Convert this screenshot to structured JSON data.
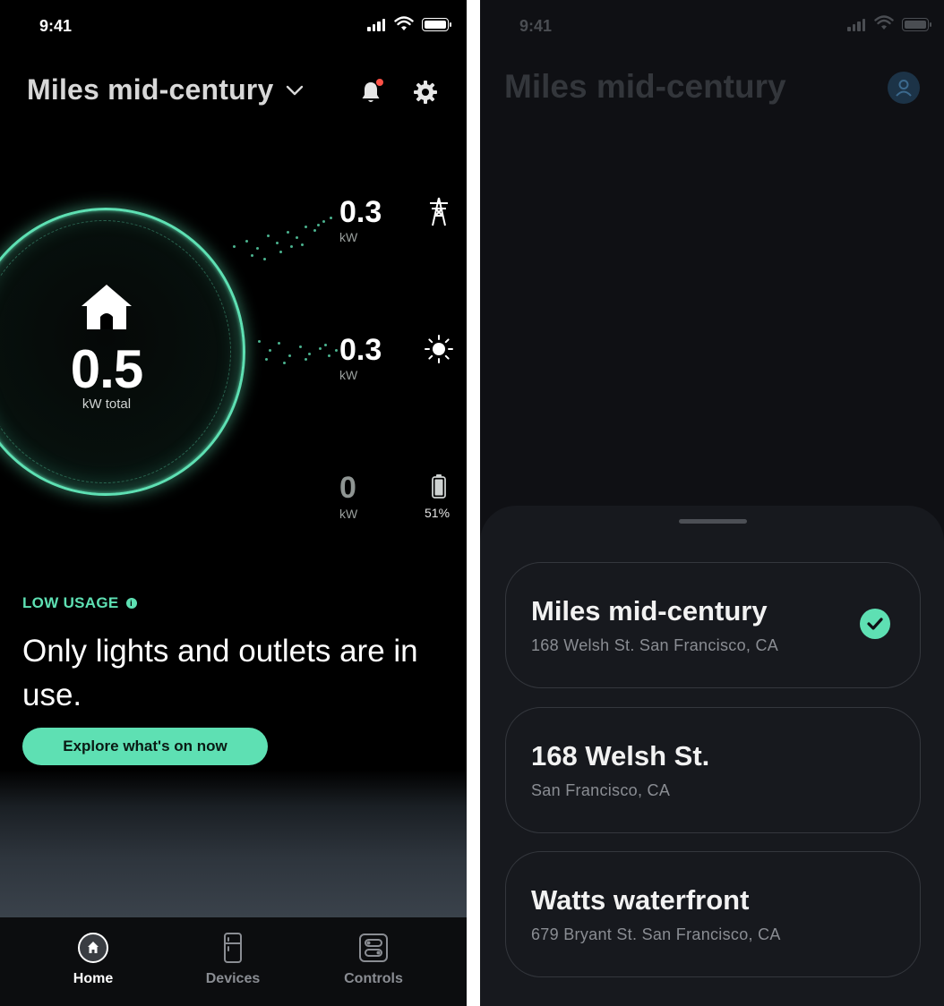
{
  "left": {
    "status": {
      "time": "9:41"
    },
    "header": {
      "home_name": "Miles mid-century"
    },
    "total": {
      "value": "0.5",
      "unit": "kW total"
    },
    "flows": [
      {
        "name": "grid",
        "value": "0.3",
        "unit": "kW",
        "icon": "power-tower-icon"
      },
      {
        "name": "solar",
        "value": "0.3",
        "unit": "kW",
        "icon": "sun-icon"
      },
      {
        "name": "battery",
        "value": "0",
        "unit": "kW",
        "icon": "battery-icon",
        "percent": "51%"
      }
    ],
    "usage": {
      "label": "LOW USAGE",
      "headline": "Only lights and outlets are in use.",
      "cta": "Explore what's on now"
    },
    "tabs": [
      {
        "label": "Home",
        "active": true
      },
      {
        "label": "Devices",
        "active": false
      },
      {
        "label": "Controls",
        "active": false
      }
    ],
    "colors": {
      "accent": "#5ee0b3",
      "notification": "#ff5147"
    }
  },
  "right": {
    "status": {
      "time": "9:41"
    },
    "title": "Miles mid-century",
    "homes": [
      {
        "name": "Miles mid-century",
        "address": "168 Welsh St. San Francisco, CA",
        "selected": true
      },
      {
        "name": "168 Welsh St.",
        "address": "San Francisco, CA",
        "selected": false
      },
      {
        "name": "Watts waterfront",
        "address": "679 Bryant St. San Francisco, CA",
        "selected": false
      }
    ]
  }
}
